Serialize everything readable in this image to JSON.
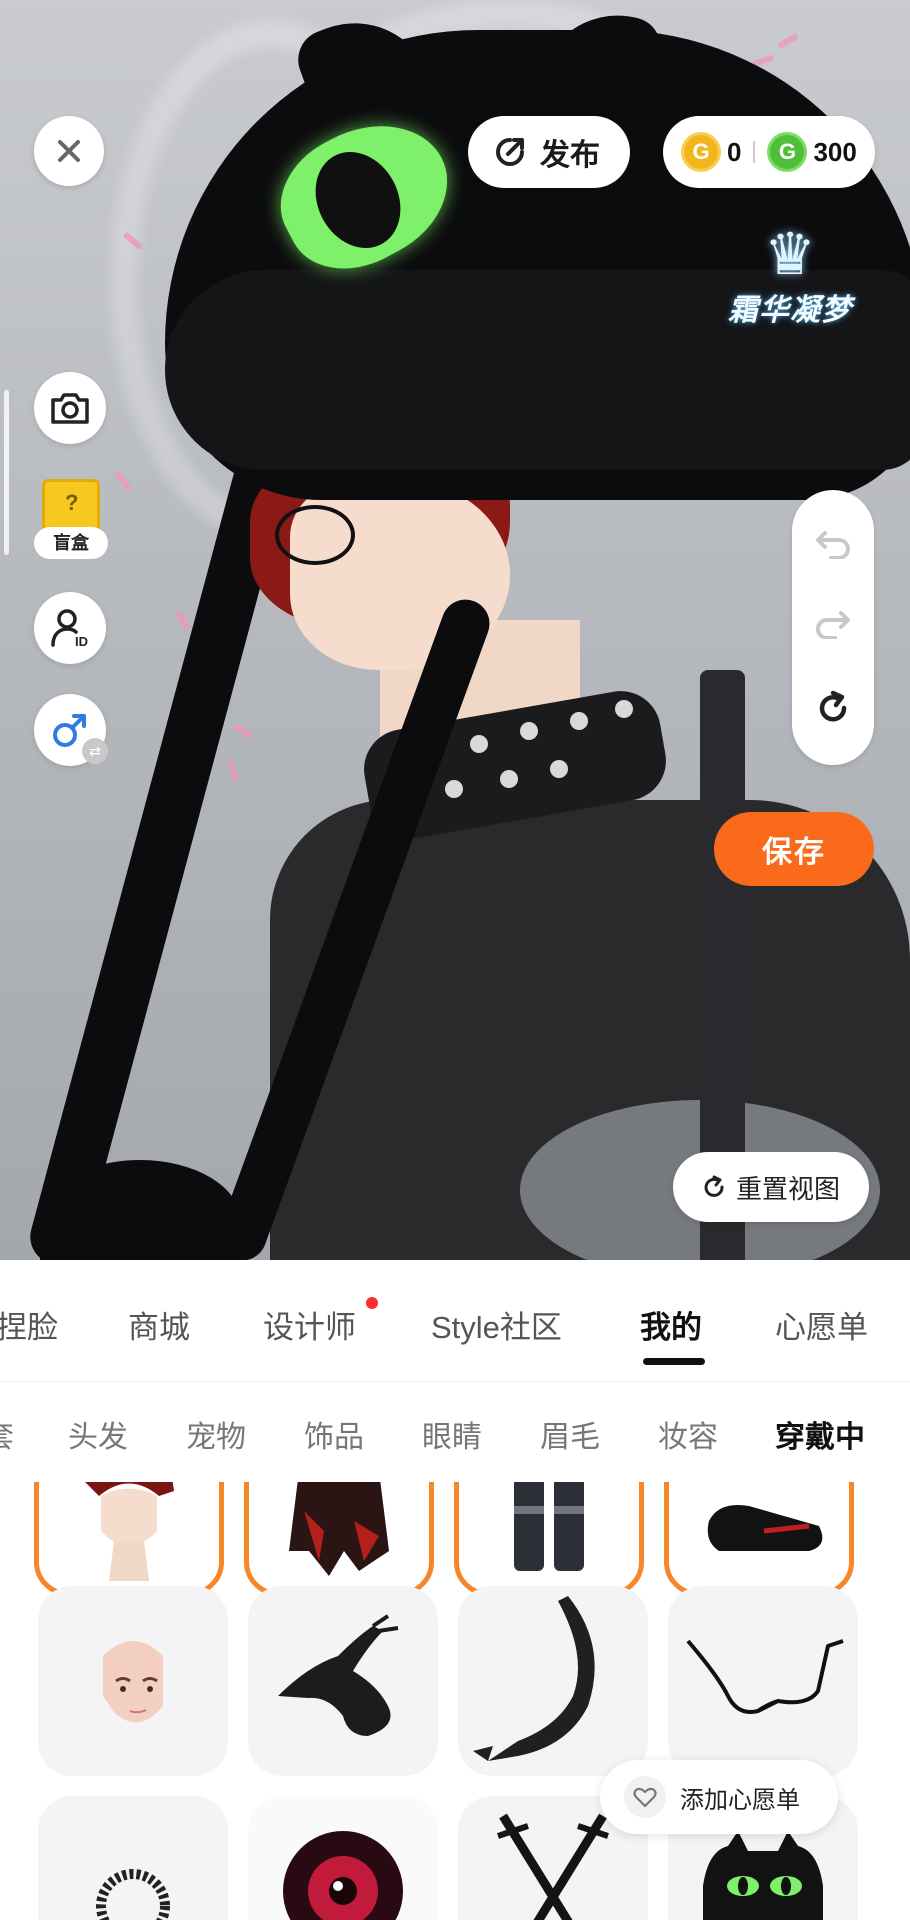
{
  "top_bar": {
    "publish_label": "发布",
    "gold_coin_count": "0",
    "green_coin_count": "300",
    "gold_coin_glyph": "G",
    "green_coin_glyph": "G"
  },
  "watermark": {
    "text": "霜华凝梦"
  },
  "left_tools": {
    "blind_box_label": "盲盒"
  },
  "right_tools": {
    "save_label": "保存",
    "reset_view_label": "重置视图"
  },
  "main_tabs": [
    {
      "label": "捏脸"
    },
    {
      "label": "商城"
    },
    {
      "label": "设计师",
      "has_dot": true
    },
    {
      "label": "Style社区"
    },
    {
      "label": "我的",
      "active": true
    },
    {
      "label": "心愿单"
    }
  ],
  "sub_tabs": [
    {
      "label": "套"
    },
    {
      "label": "头发"
    },
    {
      "label": "宠物"
    },
    {
      "label": "饰品"
    },
    {
      "label": "眼睛"
    },
    {
      "label": "眉毛"
    },
    {
      "label": "妆容"
    },
    {
      "label": "穿戴中",
      "active": true
    }
  ],
  "grid": {
    "items": [
      {
        "name": "red-hair-head",
        "selected": true
      },
      {
        "name": "red-black-top",
        "selected": true
      },
      {
        "name": "black-pants",
        "selected": true
      },
      {
        "name": "black-shoes",
        "selected": true
      },
      {
        "name": "bald-head-base",
        "selected": false
      },
      {
        "name": "black-dragon-pet",
        "selected": false
      },
      {
        "name": "spiked-tail",
        "selected": false
      },
      {
        "name": "round-glasses",
        "selected": false
      },
      {
        "name": "spiked-collar",
        "selected": false
      },
      {
        "name": "red-eye-effect",
        "selected": false
      },
      {
        "name": "crossed-swords",
        "selected": false
      },
      {
        "name": "cat-hat",
        "selected": false
      }
    ],
    "add_wishlist_label": "添加心愿单"
  },
  "colors": {
    "accent_orange": "#fa6a1b",
    "selected_border": "#f5862a",
    "gold_coin": "#f2b51d",
    "green_coin": "#4fbf3b",
    "notification_dot": "#ff2d2d"
  },
  "icons": [
    "close-icon",
    "publish-icon",
    "camera-icon",
    "blind-box-icon",
    "avatar-id-icon",
    "gender-male-icon",
    "undo-icon",
    "redo-icon",
    "refresh-icon",
    "reset-view-icon",
    "heart-icon"
  ]
}
